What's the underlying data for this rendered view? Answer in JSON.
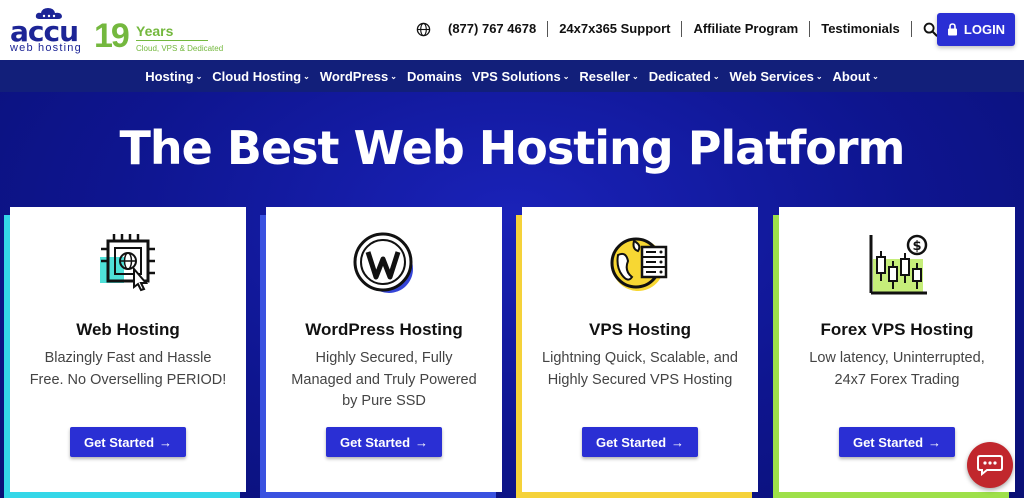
{
  "logo": {
    "brand": "accu",
    "sub": "web hosting",
    "years_number": "19",
    "years_word": "Years",
    "tagline": "Cloud, VPS & Dedicated"
  },
  "header": {
    "phone": "(877) 767 4678",
    "support": "24x7x365 Support",
    "affiliate": "Affiliate Program",
    "testimonials": "Testimonials",
    "login": "LOGIN"
  },
  "nav": [
    {
      "label": "Hosting"
    },
    {
      "label": "Cloud Hosting"
    },
    {
      "label": "WordPress"
    },
    {
      "label": "Domains"
    },
    {
      "label": "VPS Solutions"
    },
    {
      "label": "Reseller"
    },
    {
      "label": "Dedicated"
    },
    {
      "label": "Web Services"
    },
    {
      "label": "About"
    }
  ],
  "nav_caret_visible": [
    true,
    true,
    true,
    false,
    true,
    true,
    true,
    true,
    true
  ],
  "hero": {
    "title": "The Best Web Hosting Platform"
  },
  "cards": [
    {
      "title": "Web Hosting",
      "desc": "Blazingly Fast and Hassle Free. No Overselling PERIOD!",
      "button": "Get Started",
      "accent": "#34d7e8",
      "icon": "chip-globe-icon"
    },
    {
      "title": "WordPress Hosting",
      "desc": "Highly Secured, Fully Managed and Truly Powered by Pure SSD",
      "button": "Get Started",
      "accent": "#3a52e0",
      "icon": "wordpress-icon"
    },
    {
      "title": "VPS Hosting",
      "desc": "Lightning Quick, Scalable, and Highly Secured VPS Hosting",
      "button": "Get Started",
      "accent": "#f5d23a",
      "icon": "globe-server-icon"
    },
    {
      "title": "Forex VPS Hosting",
      "desc": "Low latency, Uninterrupted, 24x7 Forex Trading",
      "button": "Get Started",
      "accent": "#9ee04a",
      "icon": "candlestick-chart-icon"
    }
  ],
  "colors": {
    "primary_button": "#2a2fd4",
    "nav_bg": "#121f7a",
    "hero_bg": "#0e158f",
    "brand_green": "#74b83e",
    "chat": "#c1272d"
  }
}
